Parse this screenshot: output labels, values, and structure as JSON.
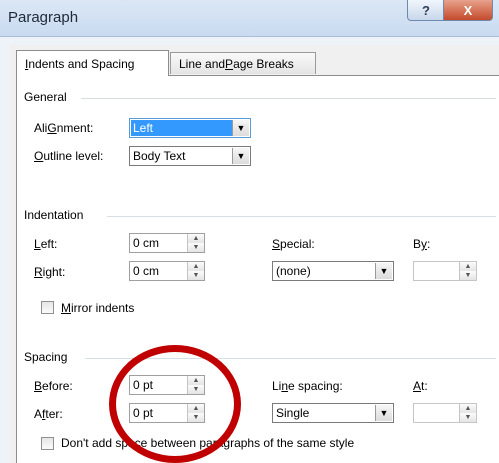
{
  "window": {
    "title": "Paragraph",
    "help_glyph": "?",
    "close_glyph": "X"
  },
  "tabs": [
    {
      "label_key": "I",
      "label_rest": "ndents and Spacing",
      "active": true
    },
    {
      "label_pre": "Line and ",
      "label_key": "P",
      "label_rest": "age Breaks",
      "active": false
    }
  ],
  "general": {
    "title": "General",
    "alignment_label_key": "G",
    "alignment_label_rest": "nment:",
    "alignment_label_pre": "Ali",
    "alignment_value": "Left",
    "outline_label_key": "O",
    "outline_label_rest": "utline level:",
    "outline_value": "Body Text"
  },
  "indentation": {
    "title": "Indentation",
    "left_label_key": "L",
    "left_label_rest": "eft:",
    "left_value": "0 cm",
    "right_label_key": "R",
    "right_label_rest": "ight:",
    "right_value": "0 cm",
    "special_label_key": "S",
    "special_label_rest": "pecial:",
    "special_value": "(none)",
    "by_label_pre": "B",
    "by_label_key": "y",
    "by_label_rest": ":",
    "mirror_label_key": "M",
    "mirror_label_rest": "irror indents"
  },
  "spacing": {
    "title": "Spacing",
    "before_label_key": "B",
    "before_label_rest": "efore:",
    "before_value": "0 pt",
    "after_label_key": "f",
    "after_label_pre": "A",
    "after_label_rest": "ter:",
    "after_value": "0 pt",
    "line_spacing_label_pre": "Li",
    "line_spacing_label_key": "n",
    "line_spacing_label_rest": "e spacing:",
    "line_spacing_value": "Single",
    "at_label_key": "A",
    "at_label_rest": "t:",
    "dont_add_label": "Don't add space between paragraphs of the same style"
  },
  "glyphs": {
    "spin_up": "▲",
    "spin_down": "▼",
    "dropdown_arrow": "▼"
  },
  "colors": {
    "annotation": "#c00000",
    "selection": "#3399ff",
    "close_button": "#c44a2b"
  }
}
